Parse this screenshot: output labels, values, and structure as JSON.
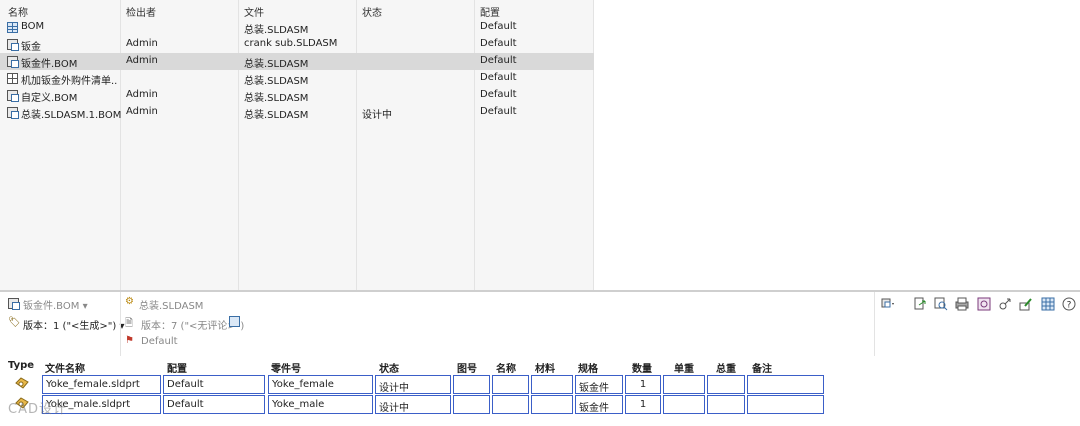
{
  "list": {
    "headers": [
      "名称",
      "检出者",
      "文件",
      "状态",
      "配置"
    ],
    "rows": [
      {
        "name": "BOM",
        "checked_out_by": "",
        "file": "总装.SLDASM",
        "status": "",
        "config": "Default",
        "icon": "bom-table-icon"
      },
      {
        "name": "钣金",
        "checked_out_by": "Admin",
        "file": "crank sub.SLDASM",
        "status": "",
        "config": "Default",
        "icon": "bom-stack-icon"
      },
      {
        "name": "钣金件.BOM",
        "checked_out_by": "Admin",
        "file": "总装.SLDASM",
        "status": "",
        "config": "Default",
        "icon": "bom-stack-icon",
        "selected": true
      },
      {
        "name": "机加钣金外购件清单...",
        "checked_out_by": "",
        "file": "总装.SLDASM",
        "status": "",
        "config": "Default",
        "icon": "bom-grid-icon"
      },
      {
        "name": "自定义.BOM",
        "checked_out_by": "Admin",
        "file": "总装.SLDASM",
        "status": "",
        "config": "Default",
        "icon": "bom-stack-icon"
      },
      {
        "name": "总装.SLDASM.1.BOM",
        "checked_out_by": "Admin",
        "file": "总装.SLDASM",
        "status": "设计中",
        "config": "Default",
        "icon": "bom-stack-icon"
      }
    ]
  },
  "info": {
    "bom_selector": "钣金件.BOM",
    "version_selector": "版本：1 (\"<生成>\")",
    "assembly_file": "总装.SLDASM",
    "assembly_version": "版本：7 (\"<无评论>\")",
    "configuration": "Default"
  },
  "toolbar": {
    "icons": [
      "view-options-icon",
      "export-icon",
      "preview-icon",
      "print-icon",
      "settings-icon",
      "link-icon",
      "edit-icon",
      "table-view-icon",
      "help-icon"
    ]
  },
  "table": {
    "headers": [
      "Type",
      "文件名称",
      "配置",
      "零件号",
      "状态",
      "图号",
      "名称",
      "材料",
      "规格",
      "数量",
      "单重",
      "总重",
      "备注"
    ],
    "rows": [
      {
        "type_icon": "part-icon",
        "file_name": "Yoke_female.sldprt",
        "config": "Default",
        "part_number": "Yoke_female",
        "status": "设计中",
        "drawing_no": "",
        "name": "",
        "material": "",
        "spec": "钣金件",
        "qty": "1",
        "unit_weight": "",
        "total_weight": "",
        "remark": ""
      },
      {
        "type_icon": "part-icon",
        "file_name": "Yoke_male.sldprt",
        "config": "Default",
        "part_number": "Yoke_male",
        "status": "设计中",
        "drawing_no": "",
        "name": "",
        "material": "",
        "spec": "钣金件",
        "qty": "1",
        "unit_weight": "",
        "total_weight": "",
        "remark": ""
      }
    ]
  },
  "watermark": "CAD设计",
  "colors": {
    "selection": "#d9d9d9",
    "cell_border": "#3b5fc8",
    "list_bg": "#f6f6f6"
  }
}
